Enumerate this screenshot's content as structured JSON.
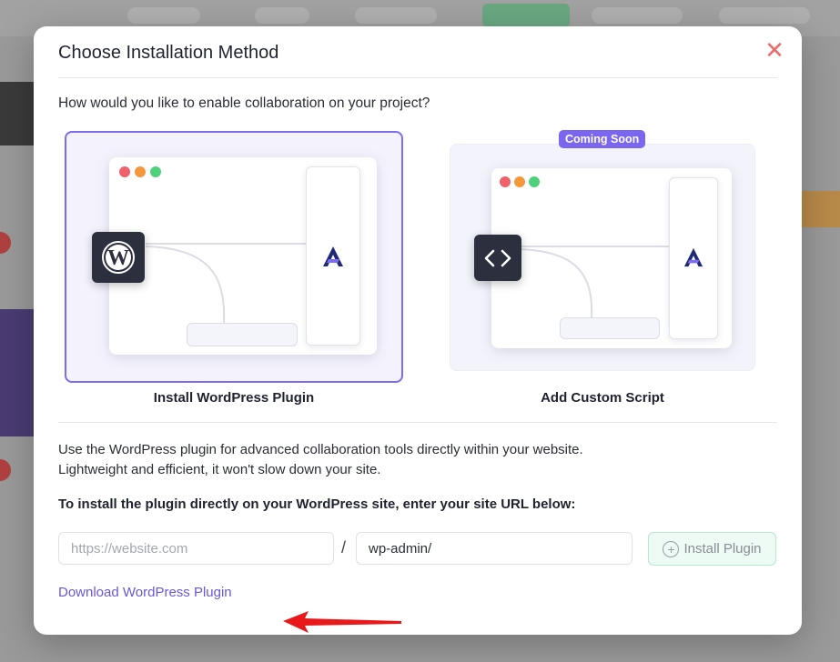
{
  "modal": {
    "title": "Choose Installation Method",
    "close_icon": "close-icon",
    "question": "How would you like to enable collaboration on your project?",
    "options": [
      {
        "label": "Install WordPress Plugin",
        "icon": "wordpress-icon",
        "selected": true
      },
      {
        "label": "Add Custom Script",
        "icon": "code-icon",
        "badge": "Coming Soon",
        "selected": false
      }
    ],
    "description_line1": "Use the WordPress plugin for advanced collaboration tools directly within your website.",
    "description_line2": "Lightweight and efficient, it won't slow down your site.",
    "instruction": "To install the plugin directly on your WordPress site, enter your site URL below:",
    "site_url": {
      "placeholder": "https://website.com",
      "value": ""
    },
    "path_separator": "/",
    "admin_path": {
      "value": "wp-admin/"
    },
    "install_button": {
      "label": "Install Plugin",
      "icon": "plus-circle-icon"
    },
    "download_link": "Download WordPress Plugin"
  },
  "colors": {
    "accent": "#7c6cf0",
    "badge": "#7b66ef",
    "close": "#ec6a6a",
    "link": "#6a58d8",
    "install_button_bg": "#eefaf4",
    "annotation_arrow": "#e8191a"
  }
}
